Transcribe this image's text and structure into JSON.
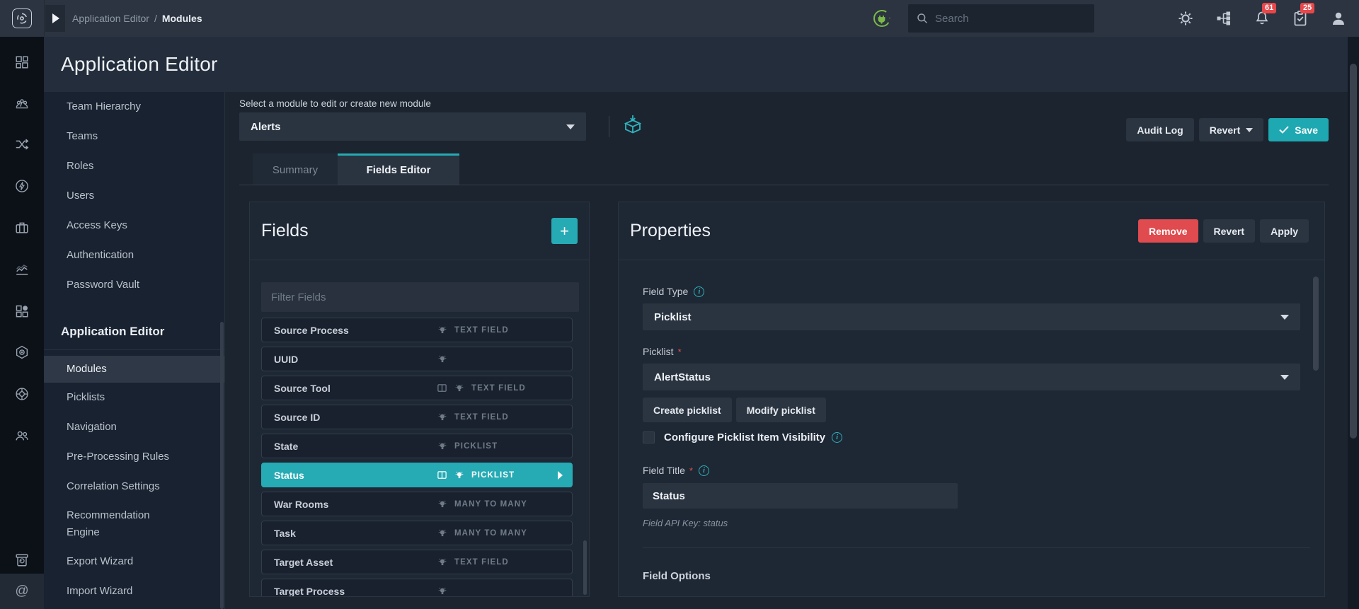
{
  "topbar": {
    "breadcrumb": {
      "parent": "Application Editor",
      "separator": "/",
      "current": "Modules"
    },
    "search_placeholder": "Search",
    "badges": {
      "notifications": "61",
      "tasks": "25"
    },
    "icons": [
      "app-logo-icon",
      "expand-play-icon",
      "plug-status-icon",
      "search-icon",
      "gear-icon",
      "workflow-icon",
      "bell-icon",
      "clipboard-check-icon",
      "user-icon"
    ]
  },
  "header": {
    "title": "Application Editor"
  },
  "rail": {
    "icons": [
      "dashboard-icon",
      "team-chart-icon",
      "shuffle-icon",
      "flash-icon",
      "briefcase-icon",
      "analytics-icon",
      "apps-icon",
      "integrations-icon",
      "support-ring-icon",
      "users-icon",
      "archive-icon",
      "mentions-icon"
    ]
  },
  "sidebar": {
    "items_top": [
      "Team Hierarchy",
      "Teams",
      "Roles",
      "Users",
      "Access Keys",
      "Authentication",
      "Password Vault"
    ],
    "section_heading": "Application Editor",
    "items_bottom": [
      "Modules",
      "Picklists",
      "Navigation",
      "Pre-Processing Rules",
      "Correlation Settings",
      "Recommendation Engine",
      "Export Wizard",
      "Import Wizard"
    ],
    "active_item": "Modules"
  },
  "module_bar": {
    "label": "Select a module to edit or create new module",
    "selected_module": "Alerts",
    "audit_log": "Audit Log",
    "revert": "Revert",
    "save": "Save"
  },
  "tabs": {
    "summary": "Summary",
    "fields_editor": "Fields Editor",
    "active": "Fields Editor"
  },
  "fields_panel": {
    "title": "Fields",
    "add_label": "+",
    "filter_placeholder": "Filter Fields",
    "fields": [
      {
        "name": "Source Process",
        "type": "TEXT FIELD"
      },
      {
        "name": "UUID",
        "type": ""
      },
      {
        "name": "Source Tool",
        "type": "TEXT FIELD",
        "has_columns_icon": true
      },
      {
        "name": "Source ID",
        "type": "TEXT FIELD"
      },
      {
        "name": "State",
        "type": "PICKLIST"
      },
      {
        "name": "Status",
        "type": "PICKLIST",
        "has_columns_icon": true,
        "selected": true
      },
      {
        "name": "War Rooms",
        "type": "MANY TO MANY"
      },
      {
        "name": "Task",
        "type": "MANY TO MANY"
      },
      {
        "name": "Target Asset",
        "type": "TEXT FIELD"
      },
      {
        "name": "Target Process",
        "type": ""
      }
    ]
  },
  "properties_panel": {
    "title": "Properties",
    "remove": "Remove",
    "revert": "Revert",
    "apply": "Apply",
    "field_type": {
      "label": "Field Type",
      "value": "Picklist"
    },
    "picklist": {
      "label": "Picklist",
      "required_mark": "*",
      "value": "AlertStatus"
    },
    "create_picklist": "Create picklist",
    "modify_picklist": "Modify picklist",
    "visibility_checkbox": {
      "label": "Configure Picklist Item Visibility",
      "checked": false
    },
    "field_title": {
      "label": "Field Title",
      "required_mark": "*",
      "value": "Status"
    },
    "api_key_note": "Field API Key: status",
    "section_heading": "Field Options",
    "info_icon_char": "i"
  },
  "colors": {
    "accent_teal": "#26aab4",
    "save_teal": "#1ea8b2",
    "danger_red": "#df4b4e",
    "badge_red": "#e8474b",
    "plug_green": "#7cb94a"
  }
}
